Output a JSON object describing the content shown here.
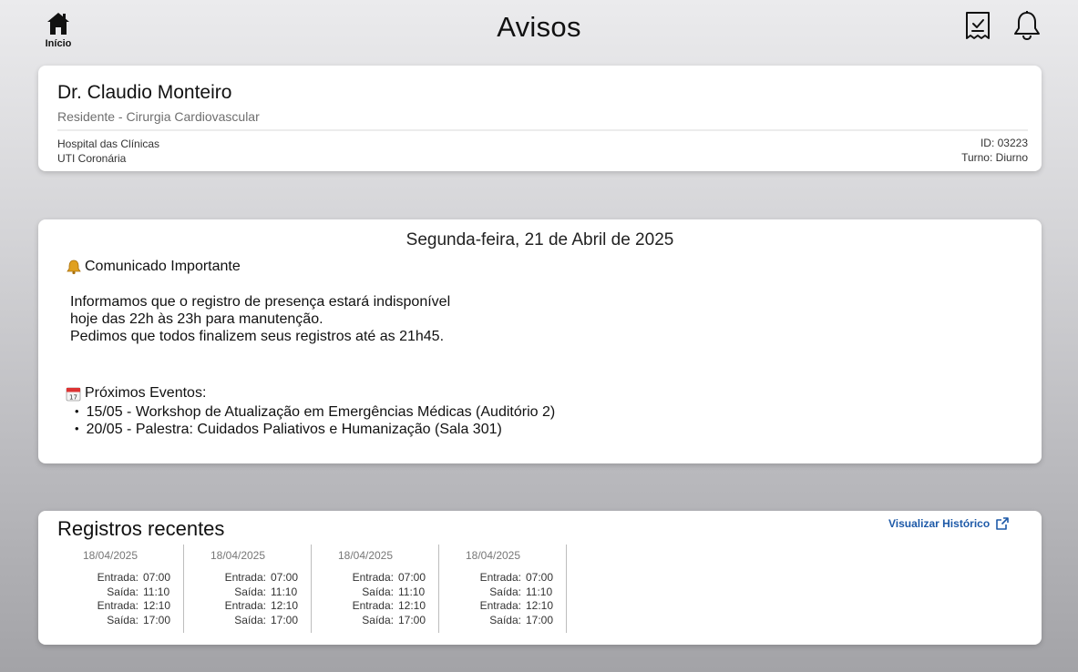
{
  "header": {
    "home_label": "Início",
    "title": "Avisos",
    "icons": [
      "home-icon",
      "checklist-icon",
      "bell-icon"
    ]
  },
  "profile": {
    "name": "Dr. Claudio Monteiro",
    "role": "Residente - Cirurgia Cardiovascular",
    "hospital": "Hospital das Clínicas",
    "unit": "UTI Coronária",
    "id": "ID: 03223",
    "shift": "Turno: Diurno"
  },
  "notice": {
    "date": "Segunda-feira, 21 de Abril de 2025",
    "heading": "Comunicado Importante",
    "body": [
      "Informamos que o registro de presença estará indisponível",
      "hoje das 22h às 23h para manutenção.",
      "Pedimos que todos finalizem seus registros até as 21h45."
    ],
    "events_heading": "Próximos Eventos:",
    "events": [
      "15/05 - Workshop de Atualização em Emergências Médicas (Auditório 2)",
      "20/05 - Palestra: Cuidados Paliativos e Humanização (Sala 301)"
    ]
  },
  "records": {
    "title": "Registros recentes",
    "history_link": "Visualizar Histórico",
    "entries": [
      {
        "date": "18/04/2025",
        "rows": [
          {
            "label": "Entrada:",
            "time": "07:00"
          },
          {
            "label": "Saída:",
            "time": "11:10"
          },
          {
            "label": "Entrada:",
            "time": "12:10"
          },
          {
            "label": "Saída:",
            "time": "17:00"
          }
        ]
      },
      {
        "date": "18/04/2025",
        "rows": [
          {
            "label": "Entrada:",
            "time": "07:00"
          },
          {
            "label": "Saída:",
            "time": "11:10"
          },
          {
            "label": "Entrada:",
            "time": "12:10"
          },
          {
            "label": "Saída:",
            "time": "17:00"
          }
        ]
      },
      {
        "date": "18/04/2025",
        "rows": [
          {
            "label": "Entrada:",
            "time": "07:00"
          },
          {
            "label": "Saída:",
            "time": "11:10"
          },
          {
            "label": "Entrada:",
            "time": "12:10"
          },
          {
            "label": "Saída:",
            "time": "17:00"
          }
        ]
      },
      {
        "date": "18/04/2025",
        "rows": [
          {
            "label": "Entrada:",
            "time": "07:00"
          },
          {
            "label": "Saída:",
            "time": "11:10"
          },
          {
            "label": "Entrada:",
            "time": "12:10"
          },
          {
            "label": "Saída:",
            "time": "17:00"
          }
        ]
      }
    ]
  },
  "colors": {
    "link": "#1e5aa8",
    "muted_text": "#6f6f6f",
    "card_bg": "#ffffff"
  }
}
